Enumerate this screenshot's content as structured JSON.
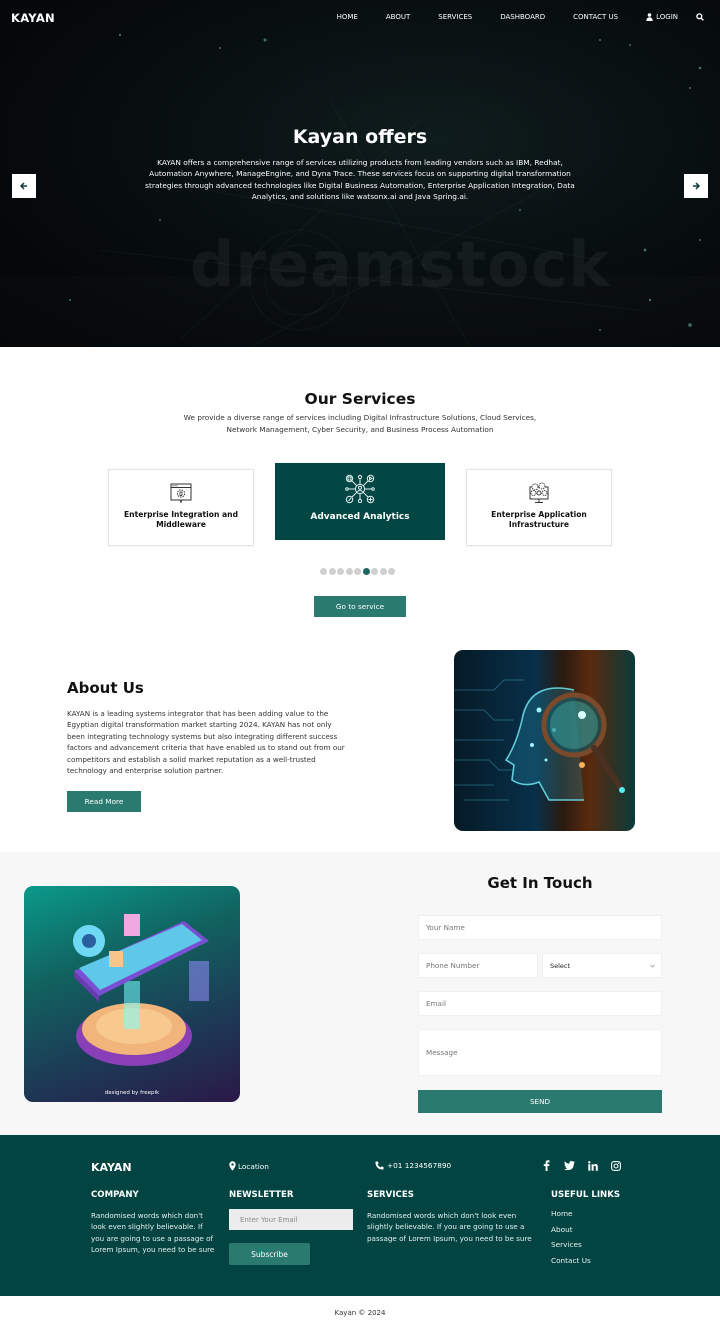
{
  "nav": {
    "brand": "KAYAN",
    "links": [
      "HOME",
      "ABOUT",
      "SERVICES",
      "DASHBOARD",
      "CONTACT US"
    ],
    "login_label": "LOGIN",
    "icons": {
      "login": "user-icon",
      "search": "search-icon"
    }
  },
  "hero": {
    "title": "Kayan offers",
    "text": "KAYAN offers a comprehensive range of services utilizing products from leading vendors such as IBM, Redhat, Automation Anywhere, ManageEngine, and Dyna Trace. These services focus on supporting digital transformation strategies through advanced technologies like Digital Business Automation, Enterprise Application Integration, Data Analytics, and solutions like watsonx.ai and Java Spring.ai.",
    "watermark": "dreamstock",
    "prev_icon": "arrow-left-icon",
    "next_icon": "arrow-right-icon"
  },
  "services": {
    "title": "Our Services",
    "subtitle": "We provide a diverse range of services including Digital Infrastructure Solutions, Cloud Services, Network Management, Cyber Security, and Business Process Automation",
    "cards": [
      {
        "label": "Enterprise Integration and Middleware",
        "icon": "browser-gear-icon",
        "active": false
      },
      {
        "label": "Advanced Analytics",
        "icon": "analytics-network-icon",
        "active": true
      },
      {
        "label": "Enterprise Application Infrastructure",
        "icon": "monitor-gears-icon",
        "active": false
      }
    ],
    "carousel": {
      "total": 9,
      "active_index": 5
    },
    "button_label": "Go to service"
  },
  "about": {
    "title": "About Us",
    "text": "KAYAN is a leading systems integrator that has been adding value to the Egyptian digital transformation market starting 2024. KAYAN has not only been integrating technology systems but also integrating different success factors and advancement criteria that have enabled us to stand out from our competitors and establish a solid market reputation as a well-trusted technology and enterprise solution partner.",
    "button_label": "Read More"
  },
  "contact": {
    "title": "Get In Touch",
    "image_credit": "designed by freepik",
    "fields": {
      "name_placeholder": "Your Name",
      "phone_placeholder": "Phone Number",
      "select_value": "Select",
      "email_placeholder": "Email",
      "message_placeholder": "Message"
    },
    "send_label": "SEND"
  },
  "footer": {
    "brand": "KAYAN",
    "location": "Location",
    "phone": "+01 1234567890",
    "socials": [
      "facebook-icon",
      "twitter-icon",
      "linkedin-icon",
      "instagram-icon"
    ],
    "company": {
      "heading": "COMPANY",
      "text": "Randomised words which don't look even slightly believable. If you are going to use a passage of Lorem Ipsum, you need to be sure"
    },
    "newsletter": {
      "heading": "NEWSLETTER",
      "placeholder": "Enter Your Email",
      "button_label": "Subscribe"
    },
    "services": {
      "heading": "SERVICES",
      "text": "Randomised words which don't look even slightly believable. If you are going to use a passage of Lorem Ipsum, you need to be sure"
    },
    "useful_links": {
      "heading": "USEFUL LINKS",
      "links": [
        "Home",
        "About",
        "Services",
        "Contact Us"
      ]
    }
  },
  "copyright": "Kayan © 2024",
  "colors": {
    "primary_dark": "#024442",
    "accent_teal": "#2b7a70",
    "active_dot": "#1e6560",
    "section_gray": "#f7f7f7"
  }
}
